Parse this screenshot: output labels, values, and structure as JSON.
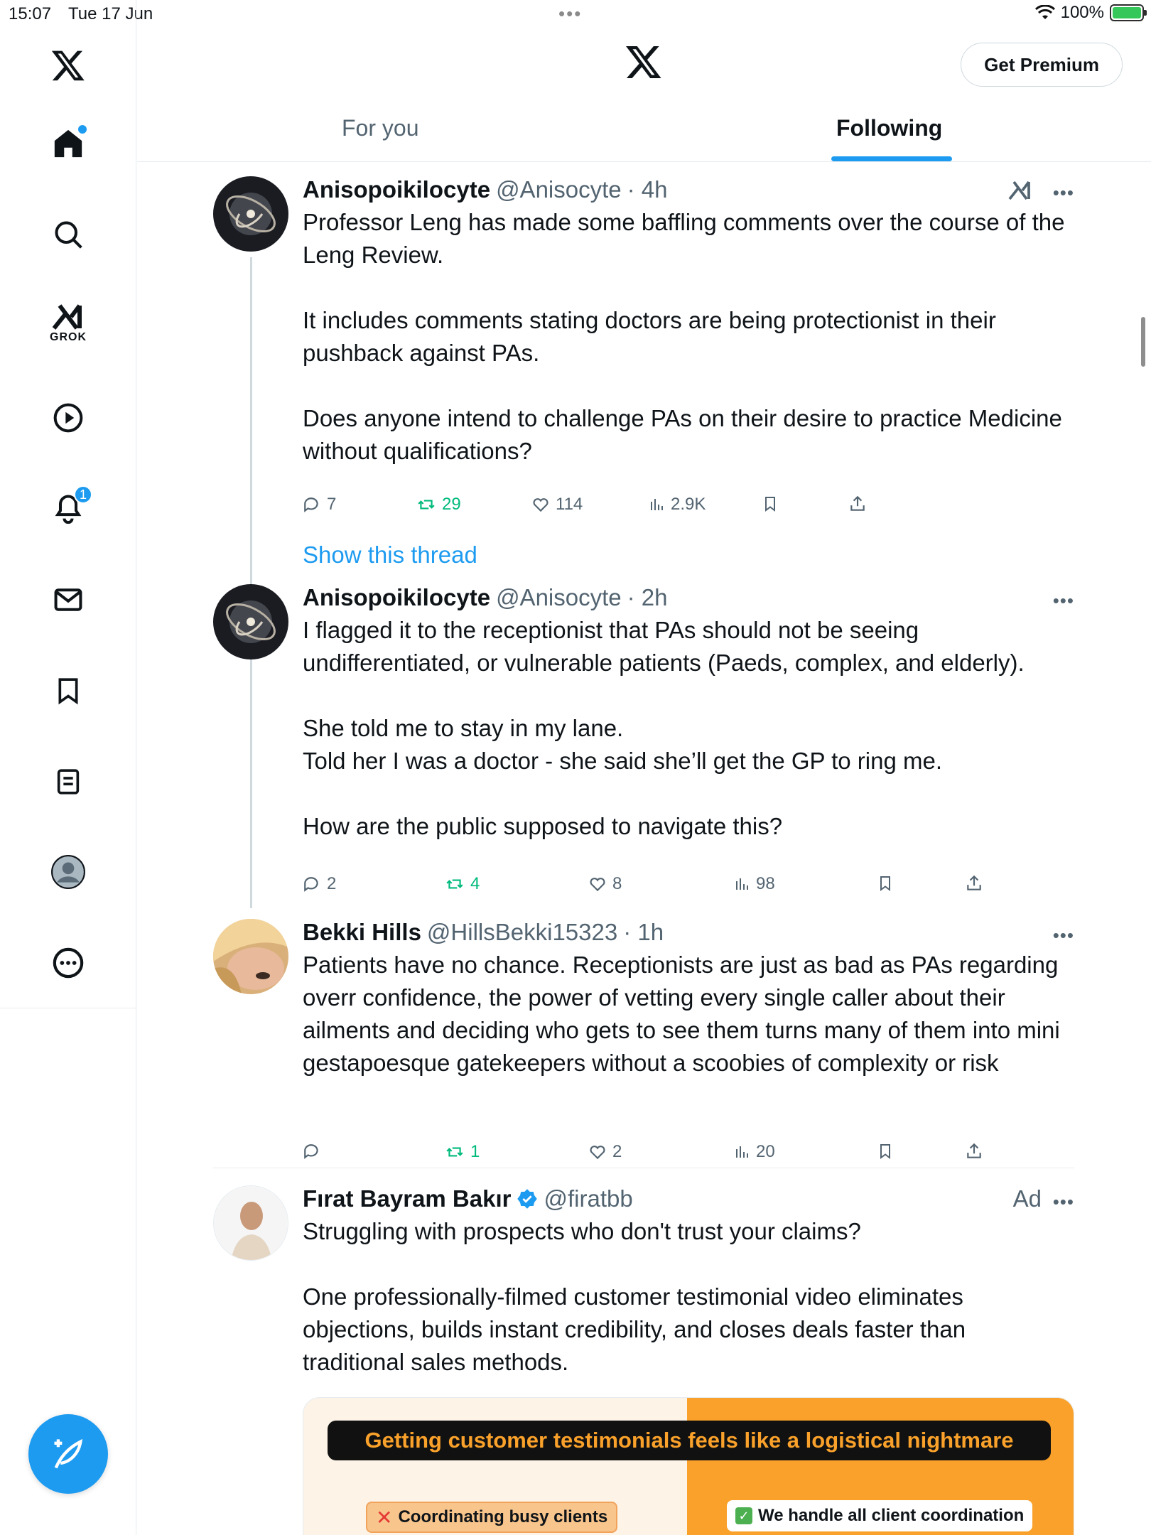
{
  "status_bar": {
    "time": "15:07",
    "date": "Tue 17 Jun",
    "battery": "100%"
  },
  "sidebar": {
    "grok_label": "GROK",
    "notification_count": "1"
  },
  "header": {
    "premium_label": "Get Premium",
    "tabs": [
      {
        "label": "For you"
      },
      {
        "label": "Following"
      }
    ]
  },
  "tweets": [
    {
      "name": "Anisopoikilocyte",
      "handle": "@Anisocyte",
      "time": "· 4h",
      "body": "Professor Leng has made some baffling comments over the course of the Leng Review.\n\nIt includes comments stating doctors are being protectionist in their pushback against PAs.\n\nDoes anyone intend to challenge PAs on their desire to practice Medicine without qualifications?",
      "replies": "7",
      "retweets": "29",
      "likes": "114",
      "views": "2.9K",
      "show_thread": "Show this thread"
    },
    {
      "name": "Anisopoikilocyte",
      "handle": "@Anisocyte",
      "time": "· 2h",
      "body": "I flagged it to the receptionist that PAs should not be seeing undifferentiated, or vulnerable patients (Paeds, complex, and elderly).\n\nShe told me to stay in my lane.\nTold her I was a doctor - she said she’ll get the GP to ring me.\n\nHow are the public supposed to navigate this?",
      "replies": "2",
      "retweets": "4",
      "likes": "8",
      "views": "98"
    },
    {
      "name": "Bekki Hills",
      "handle": "@HillsBekki15323",
      "time": "· 1h",
      "body": "Patients have no chance. Receptionists are just as bad as PAs regarding overr confidence, the power of vetting every single caller about their ailments and deciding who gets to see them turns many of them into mini gestapoesque gatekeepers without a scoobies of complexity or risk",
      "replies": "",
      "retweets": "1",
      "likes": "2",
      "views": "20"
    }
  ],
  "ad": {
    "name": "Fırat Bayram Bakır",
    "handle": "@firatbb",
    "label": "Ad",
    "body": "Struggling with prospects who don't trust your claims?\n\nOne professionally-filmed customer testimonial video eliminates objections, builds instant credibility, and closes deals faster than traditional sales methods.",
    "card_headline": "Getting customer testimonials feels like a logistical nightmare",
    "card_left": "Coordinating busy clients",
    "card_right": "We handle all client coordination"
  }
}
